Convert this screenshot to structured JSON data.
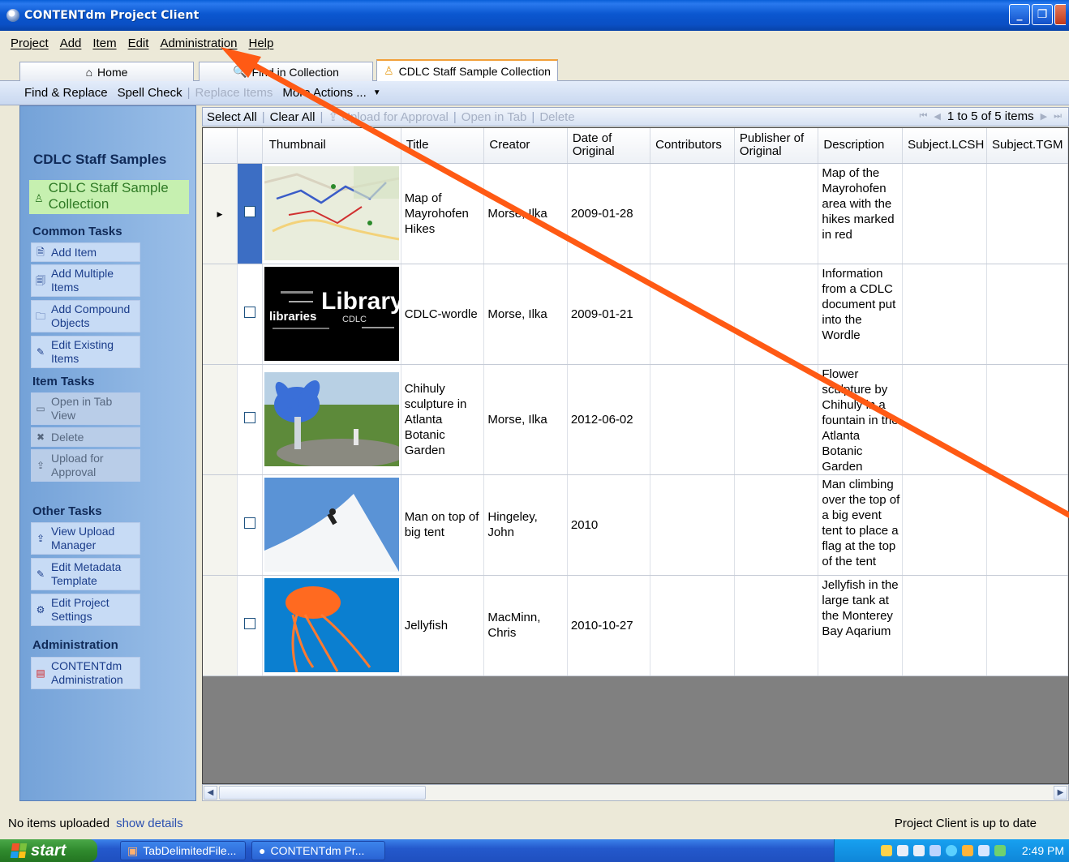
{
  "window": {
    "title": "CONTENTdm Project Client"
  },
  "menu": [
    "Project",
    "Add",
    "Item",
    "Edit",
    "Administration",
    "Help"
  ],
  "tabs": [
    "Home",
    "Find in Collection",
    "CDLC Staff Sample Collection"
  ],
  "commands": {
    "find_replace": "Find & Replace",
    "spell_check": "Spell Check",
    "replace_items": "Replace Items",
    "more_actions": "More Actions ..."
  },
  "sidebar": {
    "title": "CDLC Staff Samples",
    "collection": "CDLC Staff Sample Collection",
    "common_tasks_title": "Common Tasks",
    "common_tasks": [
      "Add Item",
      "Add Multiple Items",
      "Add Compound Objects",
      "Edit Existing Items"
    ],
    "item_tasks_title": "Item Tasks",
    "item_tasks": [
      "Open in Tab View",
      "Delete",
      "Upload for Approval"
    ],
    "other_tasks_title": "Other Tasks",
    "other_tasks": [
      "View Upload Manager",
      "Edit Metadata Template",
      "Edit Project Settings"
    ],
    "administration_title": "Administration",
    "administration": [
      "CONTENTdm Administration"
    ]
  },
  "gridbar": {
    "select_all": "Select All",
    "clear_all": "Clear All",
    "upload": "Upload for Approval",
    "open_tab": "Open in Tab",
    "delete": "Delete",
    "pager": "1 to 5 of 5 items"
  },
  "columns": [
    "Thumbnail",
    "Title",
    "Creator",
    "Date of Original",
    "Contributors",
    "Publisher of Original",
    "Description",
    "Subject.LCSH",
    "Subject.TGM"
  ],
  "rows": [
    {
      "title": "Map of Mayrohofen Hikes",
      "creator": "Morse, Ilka",
      "date": "2009-01-28",
      "description": "Map of the Mayrohofen area with the hikes marked in red",
      "selected": true,
      "thumb": "map"
    },
    {
      "title": "CDLC-wordle",
      "creator": "Morse, Ilka",
      "date": "2009-01-21",
      "description": "Information from a CDLC document put into the Wordle",
      "selected": false,
      "thumb": "wordle"
    },
    {
      "title": "Chihuly sculpture in Atlanta Botanic Garden",
      "creator": "Morse, Ilka",
      "date": "2012-06-02",
      "description": "Flower sculpture by Chihuly in a fountain in the Atlanta Botanic Garden",
      "selected": false,
      "thumb": "sculpture"
    },
    {
      "title": "Man on top of big tent",
      "creator": "Hingeley, John",
      "date": "2010",
      "description": "Man climbing over the top of a big event tent to place a flag at the top of the tent",
      "selected": false,
      "thumb": "tent"
    },
    {
      "title": "Jellyfish",
      "creator": "MacMinn, Chris",
      "date": "2010-10-27",
      "description": "Jellyfish in the large tank at the Monterey Bay Aqarium",
      "selected": false,
      "thumb": "jellyfish"
    }
  ],
  "thumb_text": {
    "library": "Library",
    "libraries": "libraries",
    "cdlc": "CDLC"
  },
  "status": {
    "left": "No items uploaded",
    "link": "show details",
    "right": "Project Client is up to date"
  },
  "taskbar": {
    "start": "start",
    "tasks": [
      "TabDelimitedFile...",
      "CONTENTdm Pr..."
    ],
    "clock": "2:49 PM"
  },
  "colors": {
    "annotation_arrow": "#ff5a14",
    "selection": "#3c6ec4",
    "sidebar": "#8cb4e4"
  }
}
